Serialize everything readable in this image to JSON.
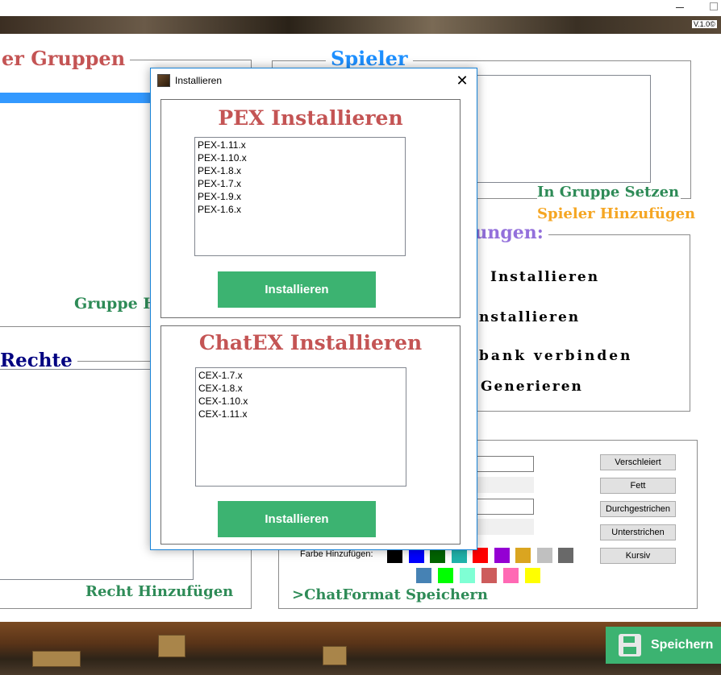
{
  "app": {
    "version": "V.1.0©",
    "save_label": "Speichern"
  },
  "groups_panel": {
    "title": "er Gruppen",
    "add_group_label": "Gruppe H"
  },
  "players_panel": {
    "title": "Spieler",
    "set_group_label": "In Gruppe Setzen",
    "add_player_label": "Spieler Hinzufügen"
  },
  "settings_panel": {
    "title": "lungen:",
    "item1": "Installieren",
    "item2": "nstallieren",
    "item3": "bank verbinden",
    "item4": "Generieren"
  },
  "rights_panel": {
    "title": "Rechte",
    "add_right_label": "Recht Hinzufügen"
  },
  "chatformat_panel": {
    "buttons": [
      "Verschleiert",
      "Fett",
      "Durchgestrichen",
      "Unterstrichen",
      "Kursiv"
    ],
    "add_color_label": "Farbe Hinzufügen:",
    "save_label": ">ChatFormat Speichern",
    "colors_row1": [
      "#000000",
      "#0000ff",
      "#006400",
      "#20b2aa",
      "#ff0000",
      "#9400d3",
      "#daa520",
      "#c0c0c0",
      "#696969"
    ],
    "colors_row2": [
      "#4682b4",
      "#00ff00",
      "#7fffd4",
      "#cd5c5c",
      "#ff69b4",
      "#ffff00"
    ]
  },
  "dialog": {
    "title": "Installieren",
    "close_glyph": "✕",
    "pex": {
      "heading": "PEX Installieren",
      "items": [
        "PEX-1.11.x",
        "PEX-1.10.x",
        "PEX-1.8.x",
        "PEX-1.7.x",
        "PEX-1.9.x",
        "PEX-1.6.x"
      ],
      "button": "Installieren"
    },
    "chatex": {
      "heading": "ChatEX Installieren",
      "items": [
        "CEX-1.7.x",
        "CEX-1.8.x",
        "CEX-1.10.x",
        "CEX-1.11.x"
      ],
      "button": "Installieren"
    }
  },
  "colors": {
    "accent_green": "#3cb371",
    "heading_red": "#c45454",
    "title_blue": "#1e90ff",
    "label_green": "#2e8b57",
    "label_orange": "#f5a623",
    "label_purple": "#9370db",
    "label_navy": "#000080"
  }
}
